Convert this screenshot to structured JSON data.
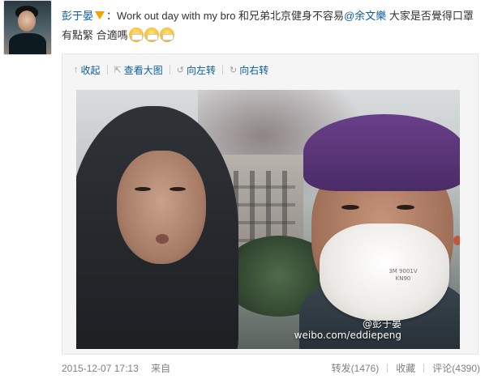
{
  "post": {
    "author": "彭于晏",
    "text_1": "：Work out day with my bro 和兄弟北京健身不容易",
    "mention": "@余文樂",
    "text_2": "大家是否覺得口罩有點緊 合適嗎",
    "emoji_count": 3
  },
  "media_toolbar": {
    "collapse": "收起",
    "view_large": "查看大图",
    "rotate_left": "向左转",
    "rotate_right": "向右转"
  },
  "photo": {
    "watermark_line1": "@彭于晏",
    "watermark_line2": "weibo.com/eddiepeng",
    "mask_label_1": "3M 9001V",
    "mask_label_2": "KN90"
  },
  "footer": {
    "timestamp": "2015-12-07 17:13",
    "source": "来自",
    "repost": "转发(1476)",
    "favorite": "收藏",
    "comment": "评论(4390)"
  },
  "colors": {
    "link": "#0a5d9e",
    "meta": "#808080",
    "media_bg": "#f5f5f5",
    "beanie": "#6a3f8a"
  },
  "icons": {
    "collapse": "arrow-up-icon",
    "view_large": "expand-icon",
    "rotate_left": "rotate-left-icon",
    "rotate_right": "rotate-right-icon",
    "verified": "verified-v-icon",
    "emoji": "mask-face-emoji"
  }
}
